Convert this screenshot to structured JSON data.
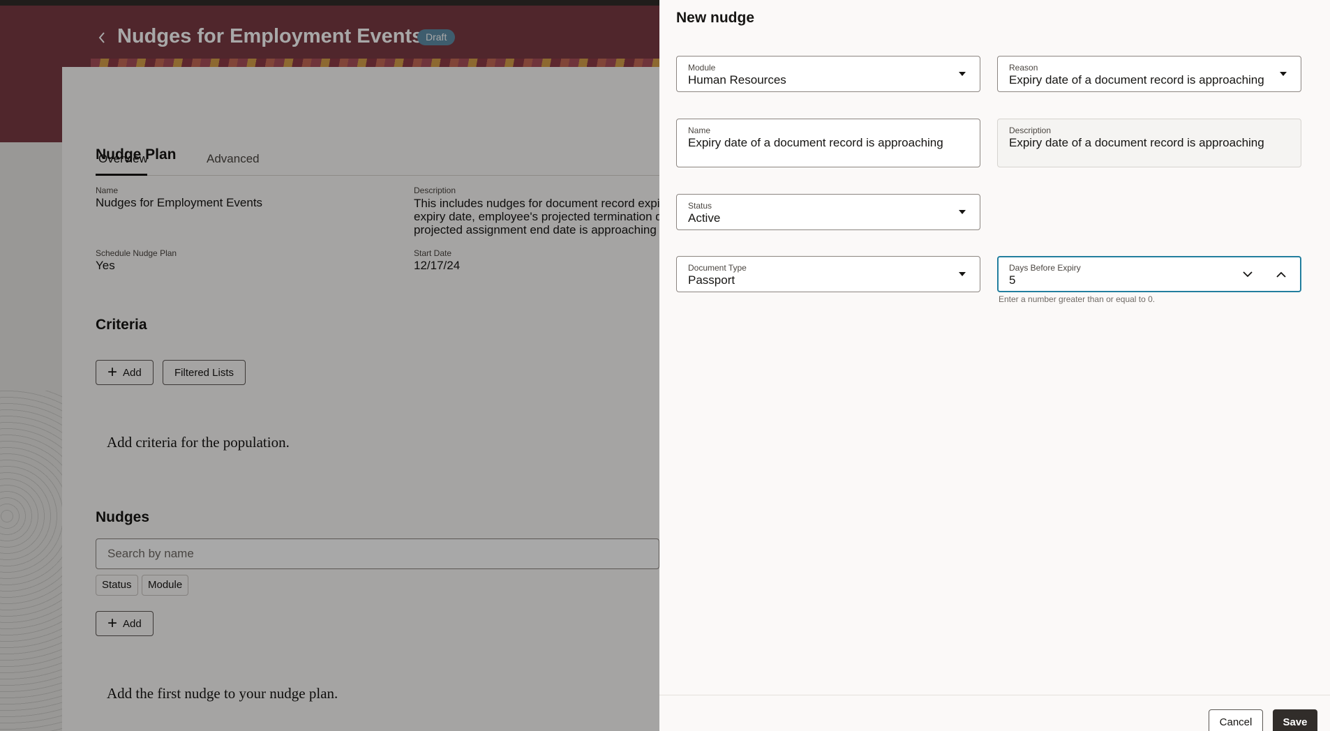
{
  "header": {
    "title": "Nudges for Employment Events",
    "badge": "Draft"
  },
  "tabs": [
    "Overview",
    "Advanced"
  ],
  "nudge_plan": {
    "heading": "Nudge Plan",
    "name_label": "Name",
    "name_value": "Nudges for Employment Events",
    "description_label": "Description",
    "description_lines": [
      "This includes nudges for document record expiry",
      "expiry date, employee's projected termination da",
      "projected assignment end date is approaching"
    ],
    "schedule_label": "Schedule Nudge Plan",
    "schedule_value": "Yes",
    "start_date_label": "Start Date",
    "start_date_value": "12/17/24"
  },
  "criteria": {
    "heading": "Criteria",
    "add_label": "Add",
    "filtered_lists_label": "Filtered Lists",
    "empty_message": "Add criteria for the population."
  },
  "nudges": {
    "heading": "Nudges",
    "search_placeholder": "Search by name",
    "filter_chips": [
      "Status",
      "Module"
    ],
    "add_label": "Add",
    "empty_message": "Add the first nudge to your nudge plan."
  },
  "drawer": {
    "title": "New nudge",
    "module": {
      "label": "Module",
      "value": "Human Resources"
    },
    "reason": {
      "label": "Reason",
      "value": "Expiry date of a document record is approaching"
    },
    "name": {
      "label": "Name",
      "value": "Expiry date of a document record is approaching"
    },
    "description": {
      "label": "Description",
      "value": "Expiry date of a document record is approaching"
    },
    "status": {
      "label": "Status",
      "value": "Active"
    },
    "document_type": {
      "label": "Document Type",
      "value": "Passport"
    },
    "days_before_expiry": {
      "label": "Days Before Expiry",
      "value": "5",
      "help": "Enter a number greater than or equal to 0."
    },
    "cancel_label": "Cancel",
    "save_label": "Save"
  }
}
